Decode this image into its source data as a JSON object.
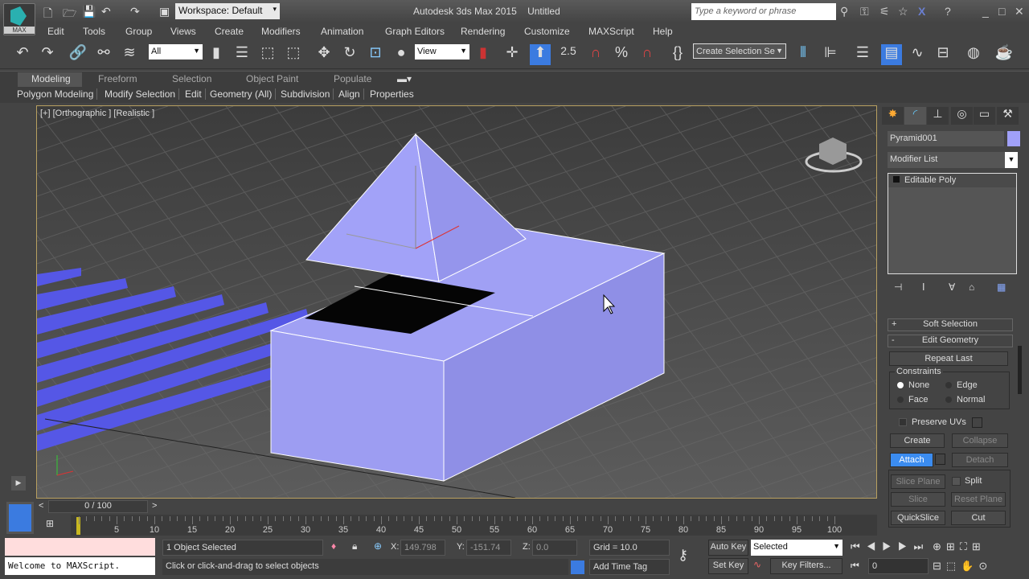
{
  "app": {
    "title": "Autodesk 3ds Max  2015",
    "document": "Untitled",
    "logo_text": "MAX",
    "workspace": "Workspace: Default",
    "search_placeholder": "Type a keyword or phrase"
  },
  "menu": [
    "Edit",
    "Tools",
    "Group",
    "Views",
    "Create",
    "Modifiers",
    "Animation",
    "Graph Editors",
    "Rendering",
    "Customize",
    "MAXScript",
    "Help"
  ],
  "toolbar": {
    "selection_filter": "All",
    "ref_coord": "View",
    "snap_angle": "2.5",
    "named_selection_placeholder": "Create Selection Se"
  },
  "ribbon": {
    "tabs": [
      "Modeling",
      "Freeform",
      "Selection",
      "Object Paint",
      "Populate"
    ],
    "active_tab": "Modeling",
    "subtabs": [
      "Polygon Modeling",
      "Modify Selection",
      "Edit",
      "Geometry (All)",
      "Subdivision",
      "Align",
      "Properties"
    ]
  },
  "viewport": {
    "label": "[+] [Orthographic ] [Realistic ]",
    "object_color": "#9f9ff5"
  },
  "command_panel": {
    "object_name": "Pyramid001",
    "object_color": "#a0a0f8",
    "modifier_list": "Modifier List",
    "stack": [
      "Editable Poly"
    ],
    "soft_selection": "Soft Selection",
    "edit_geometry": "Edit Geometry",
    "repeat_last": "Repeat Last",
    "constraints": {
      "title": "Constraints",
      "options": [
        "None",
        "Edge",
        "Face",
        "Normal"
      ],
      "selected": "None"
    },
    "preserve_uvs": "Preserve UVs",
    "create": "Create",
    "collapse": "Collapse",
    "attach": "Attach",
    "detach": "Detach",
    "slice_plane": "Slice Plane",
    "split": "Split",
    "slice": "Slice",
    "reset_plane": "Reset Plane",
    "quickslice": "QuickSlice",
    "cut": "Cut"
  },
  "timeline": {
    "position": "0 / 100",
    "ticks": [
      0,
      5,
      10,
      15,
      20,
      25,
      30,
      35,
      40,
      45,
      50,
      55,
      60,
      65,
      70,
      75,
      80,
      85,
      90,
      95,
      100
    ],
    "tick_labels": [
      "5",
      "10",
      "15",
      "20",
      "25",
      "30",
      "35",
      "40",
      "45",
      "50",
      "55",
      "60",
      "65",
      "70",
      "75",
      "80",
      "85",
      "90",
      "95",
      "100"
    ]
  },
  "status": {
    "maxscript_output": "Welcome to MAXScript.",
    "selection": "1 Object Selected",
    "prompt": "Click or click-and-drag to select objects",
    "x_label": "X:",
    "x": "149.798",
    "y_label": "Y:",
    "y": "-151.74",
    "z_label": "Z:",
    "z": "0.0",
    "grid": "Grid = 10.0",
    "add_time_tag": "Add Time Tag",
    "auto_key": "Auto Key",
    "set_key": "Set Key",
    "key_mode": "Selected",
    "key_filters": "Key Filters...",
    "current_frame": "0"
  }
}
